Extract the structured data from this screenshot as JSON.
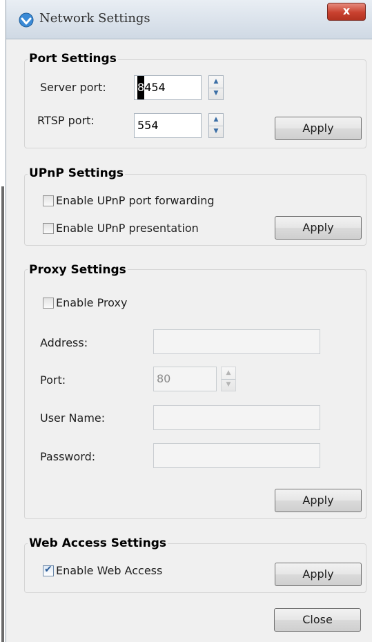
{
  "window": {
    "title": "Network Settings",
    "close_glyph": "x"
  },
  "port_settings": {
    "legend": "Port Settings",
    "server_port_label": "Server port:",
    "server_port_value_first": "8",
    "server_port_value_rest": "454",
    "rtsp_port_label": "RTSP port:",
    "rtsp_port_value": "554",
    "apply_label": "Apply"
  },
  "upnp_settings": {
    "legend": "UPnP Settings",
    "forwarding_label": "Enable UPnP port forwarding",
    "forwarding_checked": false,
    "presentation_label": "Enable UPnP presentation",
    "presentation_checked": false,
    "apply_label": "Apply"
  },
  "proxy_settings": {
    "legend": "Proxy Settings",
    "enable_label": "Enable Proxy",
    "enable_checked": false,
    "address_label": "Address:",
    "address_value": "",
    "port_label": "Port:",
    "port_value": "80",
    "username_label": "User Name:",
    "username_value": "",
    "password_label": "Password:",
    "password_value": "",
    "apply_label": "Apply"
  },
  "web_access_settings": {
    "legend": "Web Access Settings",
    "enable_label": "Enable Web Access",
    "enable_checked": true,
    "apply_label": "Apply"
  },
  "footer": {
    "close_label": "Close"
  },
  "icons": {
    "app": "network-shield-icon",
    "spin_up": "spin-up-arrow-icon",
    "spin_down": "spin-down-arrow-icon"
  }
}
